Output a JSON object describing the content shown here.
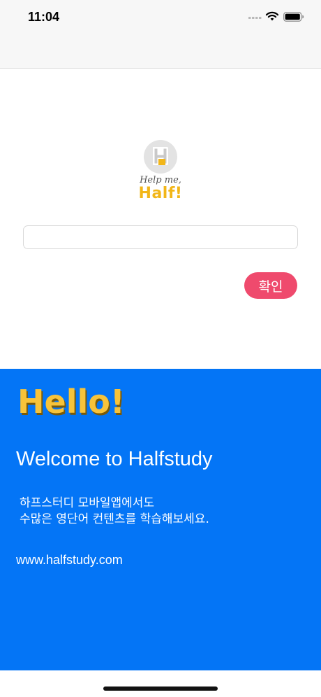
{
  "status_bar": {
    "time": "11:04"
  },
  "logo": {
    "letter": "H",
    "tagline": "Help me,",
    "name": "Half!"
  },
  "form": {
    "input_value": "",
    "input_placeholder": "",
    "confirm_label": "확인"
  },
  "info": {
    "hello": "Hello!",
    "welcome": "Welcome to Halfstudy",
    "desc_line1": "하프스터디 모바일앱에서도",
    "desc_line2": "수많은 영단어 컨텐츠를 학습해보세요.",
    "website": "www.halfstudy.com"
  },
  "colors": {
    "panel": "#0475f6",
    "confirm_button": "#ef4a6d",
    "hello": "#f7c33a",
    "logo_name": "#f2b619"
  },
  "icons": [
    "signal-icon",
    "wifi-icon",
    "battery-icon",
    "halfstudy-logo-icon"
  ]
}
